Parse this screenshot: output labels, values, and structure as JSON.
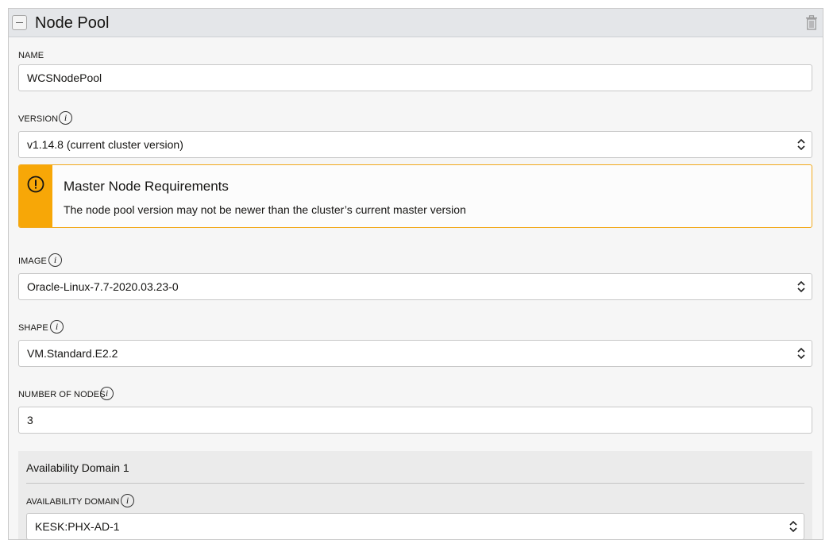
{
  "panel": {
    "title": "Node Pool"
  },
  "fields": {
    "name": {
      "label": "NAME",
      "value": "WCSNodePool"
    },
    "version": {
      "label": "VERSION",
      "value": "v1.14.8 (current cluster version)"
    },
    "image": {
      "label": "IMAGE",
      "value": "Oracle-Linux-7.7-2020.03.23-0"
    },
    "shape": {
      "label": "SHAPE",
      "value": "VM.Standard.E2.2"
    },
    "nodes": {
      "label": "NUMBER OF NODES",
      "value": "3"
    }
  },
  "warning": {
    "title": "Master Node Requirements",
    "text": "The node pool version may not be newer than the cluster’s current master version"
  },
  "availability": {
    "title": "Availability Domain 1",
    "label": "AVAILABILITY DOMAIN",
    "value": "KESK:PHX-AD-1"
  },
  "icons": {
    "info": "i",
    "trash": "trash-icon",
    "warning": "exclamation-circle-icon",
    "collapse": "minus-icon"
  },
  "colors": {
    "warning_accent": "#f7a707",
    "header_bg": "#e4e6e9"
  }
}
